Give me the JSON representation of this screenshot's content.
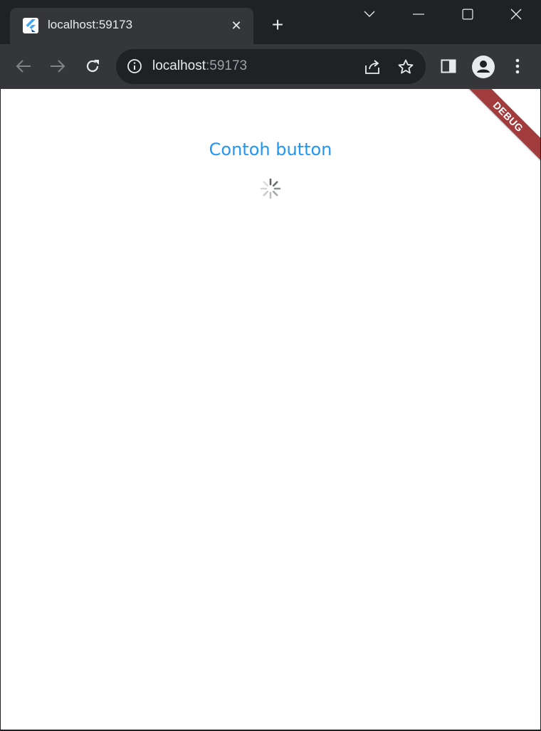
{
  "browser": {
    "tab": {
      "title": "localhost:59173",
      "close_label": "✕",
      "favicon": "flutter-icon"
    },
    "new_tab_label": "+",
    "window_controls": [
      "chevron-down-icon",
      "minimize-icon",
      "maximize-icon",
      "close-icon"
    ],
    "address": {
      "host": "localhost",
      "port": ":59173"
    },
    "colors": {
      "frame": "#202124",
      "toolbar": "#35363a",
      "text": "#e8eaed"
    }
  },
  "app": {
    "button_label": "Contoh button",
    "button_color": "#2196f3",
    "debug_banner": "DEBUG",
    "banner_color": "#a23b3b",
    "loading_indicator": "cupertino-activity-spinner"
  }
}
